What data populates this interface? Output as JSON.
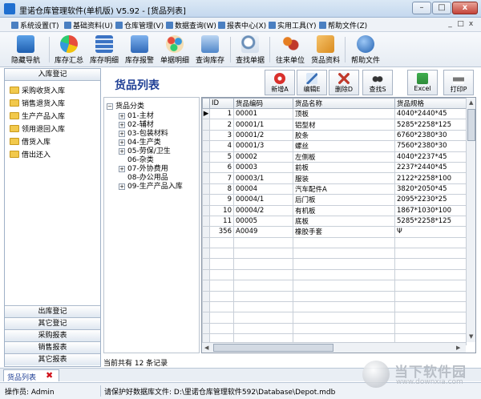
{
  "window": {
    "title": "里诺仓库管理软件(单机版) V5.92 - [货品列表]",
    "min_label": "–",
    "max_label": "□",
    "close_label": "x"
  },
  "menubar": {
    "items": [
      "系统设置(T)",
      "基础资料(U)",
      "仓库管理(V)",
      "数据查询(W)",
      "报表中心(X)",
      "实用工具(Y)",
      "帮助文件(Z)"
    ],
    "mdi": [
      "_",
      "□",
      "x"
    ]
  },
  "toolbar": {
    "items": [
      {
        "label": "隐藏导航",
        "icon": "monitor-icon"
      },
      {
        "label": "库存汇总",
        "icon": "chart-icon"
      },
      {
        "label": "库存明细",
        "icon": "grid-icon"
      },
      {
        "label": "库存报警",
        "icon": "alarm-icon"
      },
      {
        "label": "单据明细",
        "icon": "palette-icon"
      },
      {
        "label": "查询库存",
        "icon": "monitor-search-icon"
      },
      {
        "label": "查找单据",
        "icon": "magnifier-icon"
      },
      {
        "label": "往来单位",
        "icon": "users-icon"
      },
      {
        "label": "货品资料",
        "icon": "box-icon"
      },
      {
        "label": "帮助文件",
        "icon": "help-icon"
      }
    ]
  },
  "leftnav": {
    "header": "入库登记",
    "items": [
      "采购收货入库",
      "销售退货入库",
      "生产产品入库",
      "领用退回入库",
      "借货入库",
      "借出还入"
    ],
    "groups": [
      "出库登记",
      "其它登记",
      "采购报表",
      "销售报表",
      "其它报表"
    ]
  },
  "page": {
    "title": "货品列表",
    "record_count": "当前共有 12 条记录"
  },
  "actions": [
    {
      "label": "新增A",
      "icon": "add-icon",
      "color": "#d9302c"
    },
    {
      "label": "编辑E",
      "icon": "edit-icon",
      "color": "#3a6fb5"
    },
    {
      "label": "删除D",
      "icon": "delete-icon",
      "color": "#c0392b"
    },
    {
      "label": "查找S",
      "icon": "binoculars-icon",
      "color": "#333333"
    },
    {
      "label": "Excel",
      "icon": "excel-icon",
      "color": "#2e8b3a"
    },
    {
      "label": "打印P",
      "icon": "printer-icon",
      "color": "#555555"
    }
  ],
  "tree": {
    "root": "货品分类",
    "children": [
      {
        "label": "01-主材",
        "expandable": true
      },
      {
        "label": "02-辅材",
        "expandable": true
      },
      {
        "label": "03-包装材料",
        "expandable": true
      },
      {
        "label": "04-生产类",
        "expandable": true
      },
      {
        "label": "05-劳保/卫生",
        "expandable": true
      },
      {
        "label": "06-杂类",
        "expandable": false
      },
      {
        "label": "07-外协费用",
        "expandable": true
      },
      {
        "label": "08-办公用品",
        "expandable": false
      },
      {
        "label": "09-生产产品入库",
        "expandable": true
      }
    ]
  },
  "grid": {
    "columns": [
      "ID",
      "货品编码",
      "货品名称",
      "货品规格"
    ],
    "rows": [
      [
        "1",
        "00001",
        "顶板",
        "4040*2440*45"
      ],
      [
        "2",
        "00001/1",
        "铝型材",
        "5285*2258*125"
      ],
      [
        "3",
        "00001/2",
        "胶条",
        "6760*2380*30"
      ],
      [
        "4",
        "00001/3",
        "螺丝",
        "7560*2380*30"
      ],
      [
        "5",
        "00002",
        "左侧板",
        "4040*2237*45"
      ],
      [
        "6",
        "00003",
        "前板",
        "2237*2440*45"
      ],
      [
        "7",
        "00003/1",
        "服装",
        "2122*2258*100"
      ],
      [
        "8",
        "00004",
        "汽车配件A",
        "3820*2050*45"
      ],
      [
        "9",
        "00004/1",
        "后门板",
        "2095*2230*25"
      ],
      [
        "10",
        "00004/2",
        "有机板",
        "1867*1030*100"
      ],
      [
        "11",
        "00005",
        "底板",
        "5285*2258*125"
      ],
      [
        "356",
        "A0049",
        "橡胶手套",
        "Ψ"
      ]
    ]
  },
  "tabs": {
    "doc_tab": "货品列表"
  },
  "status": {
    "operator": "操作员: Admin",
    "backup_notice": "请保护好数据库文件: D:\\里诺仓库管理软件592\\Database\\Depot.mdb"
  },
  "watermark": {
    "text": "当下软件园",
    "subtext": "www.downxia.com"
  }
}
